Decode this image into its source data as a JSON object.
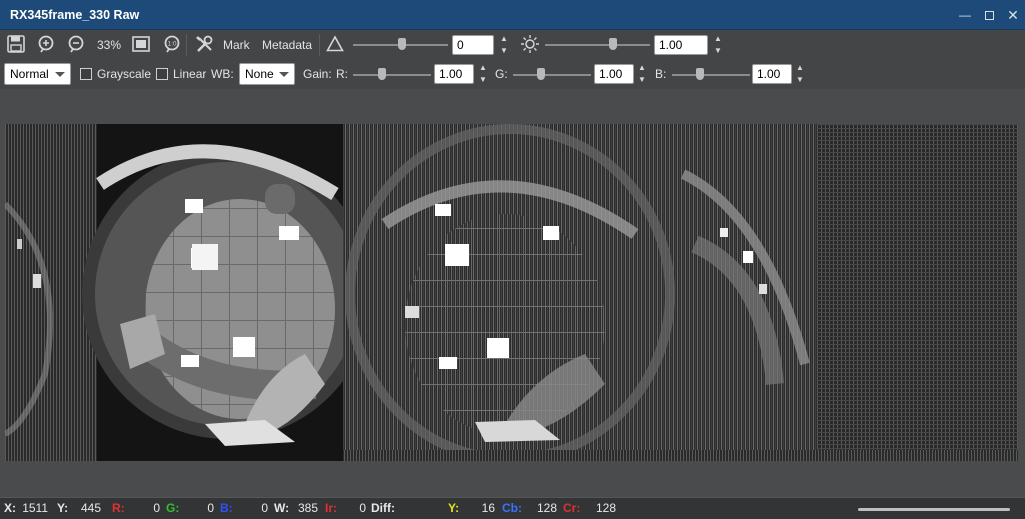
{
  "window": {
    "title": "RX345frame_330 Raw",
    "buttons": [
      "minimize",
      "maximize",
      "close"
    ]
  },
  "toolbar1": {
    "zoom": "33%",
    "mark_label": "Mark",
    "metadata_label": "Metadata",
    "contrast_value": "0",
    "brightness_value": "1.00",
    "icons": [
      "save-icon",
      "zoom-in-icon",
      "zoom-out-icon",
      "fit-icon",
      "actual-size-icon",
      "tools-icon",
      "contrast-icon",
      "brightness-icon"
    ]
  },
  "toolbar2": {
    "mode_select": "Normal",
    "grayscale_label": "Grayscale",
    "linear_label": "Linear",
    "wb_label": "WB:",
    "wb_select": "None",
    "gain_label": "Gain:",
    "r_label": "R:",
    "r_value": "1.00",
    "g_label": "G:",
    "g_value": "1.00",
    "b_label": "B:",
    "b_value": "1.00"
  },
  "status": {
    "x_label": "X:",
    "x": "1511",
    "y_label": "Y:",
    "y": "445",
    "r_label": "R:",
    "r": "0",
    "g_label": "G:",
    "g": "0",
    "b_label": "B:",
    "b": "0",
    "w_label": "W:",
    "w": "385",
    "ir_label": "Ir:",
    "ir": "0",
    "diff_label": "Diff:",
    "yy_label": "Y:",
    "yy": "16",
    "cb_label": "Cb:",
    "cb": "128",
    "cr_label": "Cr:",
    "cr": "128"
  },
  "colors": {
    "titlebar": "#1d4a78",
    "toolbar": "#444547",
    "status_r": "#e03030",
    "status_g": "#30c030",
    "status_b": "#3050ff",
    "status_y": "#e8e020",
    "status_cb": "#3a70ff",
    "status_cr": "#e03030"
  }
}
